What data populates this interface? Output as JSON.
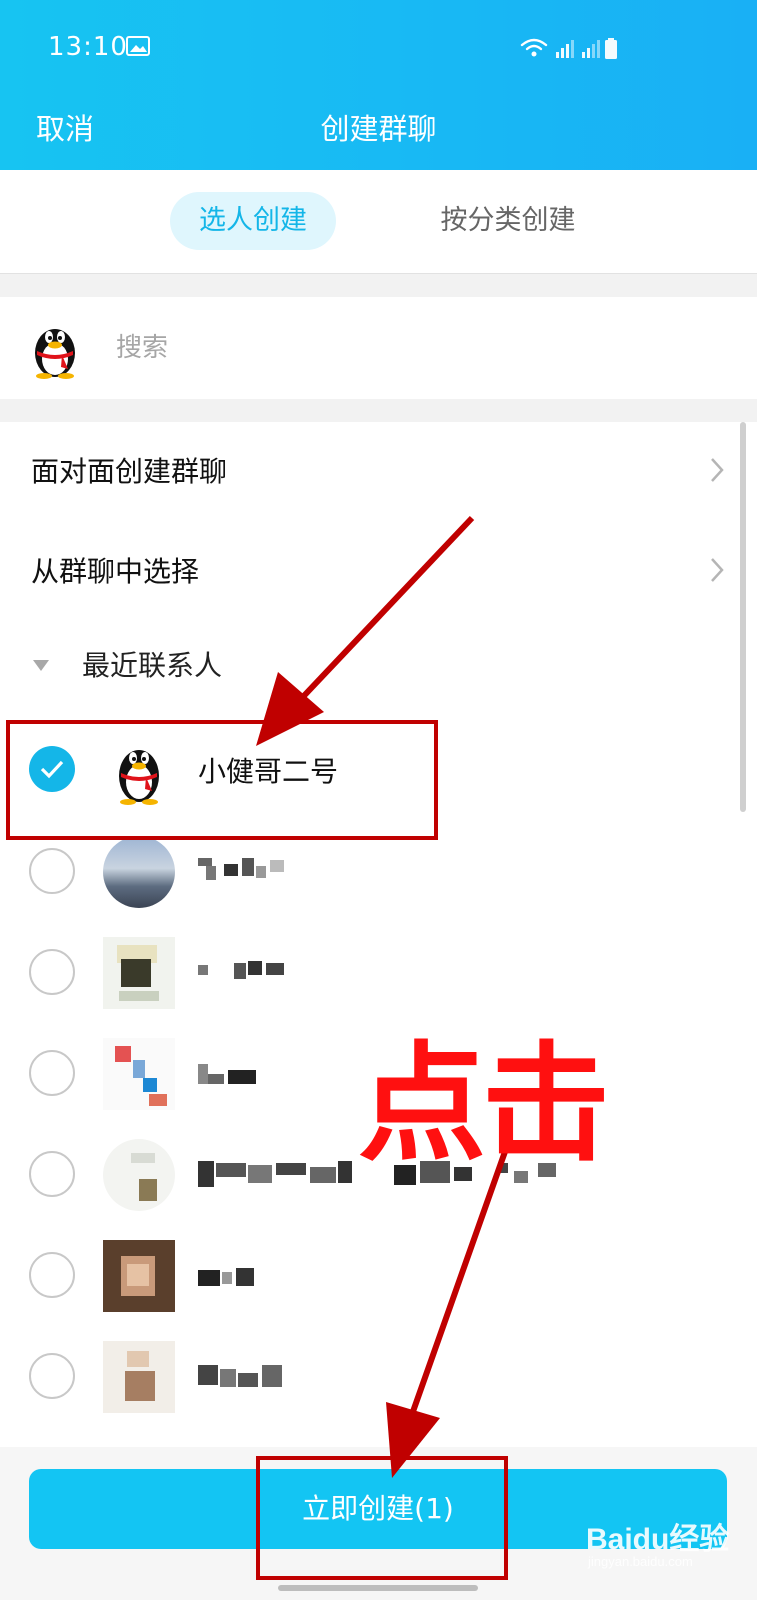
{
  "status_bar": {
    "time": "13:10"
  },
  "nav": {
    "cancel_label": "取消",
    "title": "创建群聊"
  },
  "tabs": [
    {
      "label": "选人创建",
      "active": true
    },
    {
      "label": "按分类创建",
      "active": false
    }
  ],
  "search": {
    "placeholder": "搜索"
  },
  "menu": [
    {
      "label": "面对面创建群聊"
    },
    {
      "label": "从群聊中选择"
    }
  ],
  "recent": {
    "header": "最近联系人",
    "contacts": [
      {
        "name": "小健哥二号",
        "selected": true
      }
    ]
  },
  "create_button": {
    "label": "立即创建(1)"
  },
  "annotation": {
    "text": "点击",
    "color": "#ff1010"
  },
  "watermark": {
    "brand": "Baidu经验",
    "sub": "jingyan.baidu.com"
  },
  "colors": {
    "accent": "#14b6e8",
    "header": "#17c4f2",
    "annotation_red": "#c00000"
  }
}
